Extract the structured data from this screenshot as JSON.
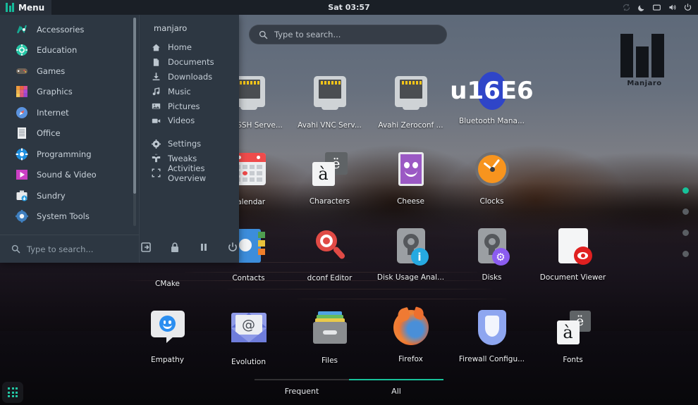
{
  "topbar": {
    "menu_label": "Menu",
    "clock": "Sat 03:57",
    "tray_icons": [
      "sync-icon",
      "night-light-icon",
      "display-icon",
      "volume-icon",
      "power-icon"
    ]
  },
  "menu": {
    "categories": [
      {
        "label": "Accessories",
        "icon": "accessories-icon"
      },
      {
        "label": "Education",
        "icon": "education-icon"
      },
      {
        "label": "Games",
        "icon": "games-icon"
      },
      {
        "label": "Graphics",
        "icon": "graphics-icon"
      },
      {
        "label": "Internet",
        "icon": "internet-icon"
      },
      {
        "label": "Office",
        "icon": "office-icon"
      },
      {
        "label": "Programming",
        "icon": "programming-icon"
      },
      {
        "label": "Sound & Video",
        "icon": "sound-video-icon"
      },
      {
        "label": "Sundry",
        "icon": "sundry-icon"
      },
      {
        "label": "System Tools",
        "icon": "system-tools-icon"
      }
    ],
    "search_placeholder": "Type to search...",
    "user": "manjaro",
    "places": [
      {
        "label": "Home",
        "icon": "home-icon"
      },
      {
        "label": "Documents",
        "icon": "document-icon"
      },
      {
        "label": "Downloads",
        "icon": "download-icon"
      },
      {
        "label": "Music",
        "icon": "music-note-icon"
      },
      {
        "label": "Pictures",
        "icon": "picture-icon"
      },
      {
        "label": "Videos",
        "icon": "video-camera-icon"
      }
    ],
    "system": [
      {
        "label": "Settings",
        "icon": "gear-icon"
      },
      {
        "label": "Tweaks",
        "icon": "tweaks-icon"
      },
      {
        "label": "Activities Overview",
        "icon": "fullscreen-icon"
      }
    ],
    "session_buttons": [
      "logout-icon",
      "lock-icon",
      "suspend-icon",
      "power-icon"
    ]
  },
  "overview": {
    "search_placeholder": "Type to search...",
    "watermark": "Manjaro",
    "apps": [
      {
        "label": "",
        "icon": "archive-manager-icon",
        "occluded": true
      },
      {
        "label": "Avahi SSH Serve...",
        "icon": "ethernet-icon"
      },
      {
        "label": "Avahi VNC Serv...",
        "icon": "ethernet-icon"
      },
      {
        "label": "Avahi Zeroconf ...",
        "icon": "ethernet-icon"
      },
      {
        "label": "Bluetooth Mana...",
        "icon": "bluetooth-icon"
      },
      {
        "label": "",
        "icon": "blank",
        "occluded": true
      },
      {
        "label": "",
        "icon": "calculator-icon",
        "occluded": true
      },
      {
        "label": "Calendar",
        "icon": "calendar-icon"
      },
      {
        "label": "Characters",
        "icon": "characters-icon"
      },
      {
        "label": "Cheese",
        "icon": "cheese-icon"
      },
      {
        "label": "Clocks",
        "icon": "clocks-icon"
      },
      {
        "label": "",
        "icon": "blank",
        "occluded": true
      },
      {
        "label": "CMake",
        "icon": "cmake-icon"
      },
      {
        "label": "Contacts",
        "icon": "contacts-icon"
      },
      {
        "label": "dconf Editor",
        "icon": "dconf-editor-icon"
      },
      {
        "label": "Disk Usage Anal...",
        "icon": "disk-usage-icon"
      },
      {
        "label": "Disks",
        "icon": "disks-icon"
      },
      {
        "label": "Document Viewer",
        "icon": "document-viewer-icon"
      },
      {
        "label": "Empathy",
        "icon": "empathy-icon"
      },
      {
        "label": "Evolution",
        "icon": "evolution-icon"
      },
      {
        "label": "Files",
        "icon": "files-icon"
      },
      {
        "label": "Firefox",
        "icon": "firefox-icon"
      },
      {
        "label": "Firewall Configu...",
        "icon": "firewall-icon"
      },
      {
        "label": "Fonts",
        "icon": "fonts-icon"
      }
    ],
    "page_dots": [
      {
        "active": true
      },
      {
        "active": false
      },
      {
        "active": false
      },
      {
        "active": false
      }
    ],
    "tabs": [
      {
        "label": "Frequent",
        "active": false
      },
      {
        "label": "All",
        "active": true
      }
    ],
    "show_apps_icon": "grid-apps-icon"
  },
  "colors": {
    "accent_teal": "#17c29a",
    "panel_bg": "#2d3742",
    "topbar_bg": "#1a1f26",
    "menu_button_bg": "#272e38"
  }
}
